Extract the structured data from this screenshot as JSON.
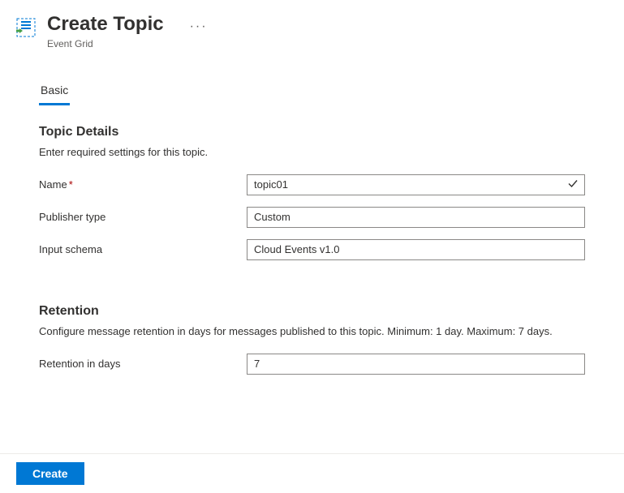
{
  "header": {
    "title": "Create Topic",
    "subtitle": "Event Grid"
  },
  "tabs": {
    "basic": "Basic"
  },
  "topicDetails": {
    "heading": "Topic Details",
    "description": "Enter required settings for this topic.",
    "nameLabel": "Name",
    "nameValue": "topic01",
    "publisherTypeLabel": "Publisher type",
    "publisherTypeValue": "Custom",
    "inputSchemaLabel": "Input schema",
    "inputSchemaValue": "Cloud Events v1.0"
  },
  "retention": {
    "heading": "Retention",
    "description": "Configure message retention in days for messages published to this topic. Minimum: 1 day. Maximum: 7 days.",
    "retentionLabel": "Retention in days",
    "retentionValue": "7"
  },
  "footer": {
    "createLabel": "Create"
  }
}
